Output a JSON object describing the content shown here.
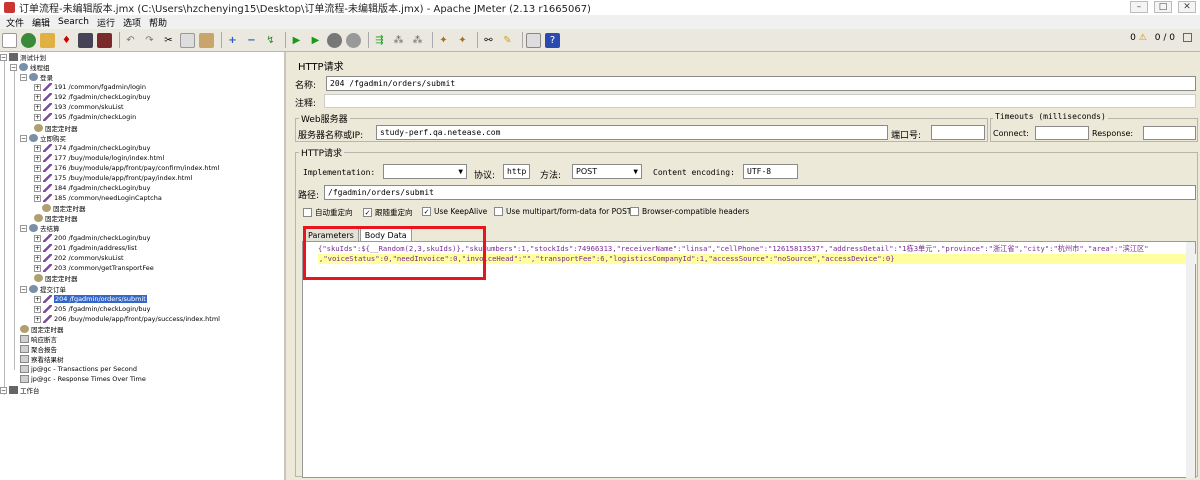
{
  "window": {
    "title": "订单流程-未编辑版本.jmx (C:\\Users\\hzchenying15\\Desktop\\订单流程-未编辑版本.jmx) - Apache JMeter (2.13 r1665067)"
  },
  "menu": [
    "文件",
    "编辑",
    "Search",
    "运行",
    "选项",
    "帮助"
  ],
  "status": {
    "warnings": "0",
    "threads": "0 / 0"
  },
  "tree": {
    "root": "测试计划",
    "group": "线程组",
    "items": [
      "登录",
      "191 /common/fgadmin/login",
      "192 /fgadmin/checkLogin/buy",
      "193 /common/skuList",
      "195 /fgadmin/checkLogin",
      "固定定时器",
      "立即购买",
      "174 /fgadmin/checkLogin/buy",
      "177 /buy/module/login/index.html",
      "176 /buy/module/app/front/pay/confirm/index.html",
      "175 /buy/module/app/front/pay/index.html",
      "184 /fgadmin/checkLogin/buy",
      "185 /common/needLoginCaptcha",
      "固定定时器",
      "固定定时器",
      "去结算",
      "200 /fgadmin/checkLogin/buy",
      "201 /fgadmin/address/list",
      "202 /common/skuList",
      "203 /common/getTransportFee",
      "固定定时器",
      "提交订单",
      "204 /fgadmin/orders/submit",
      "205 /fgadmin/checkLogin/buy",
      "206 /buy/module/app/front/pay/success/index.html",
      "固定定时器",
      "响应断言",
      "聚合报告",
      "察看结果树",
      "jp@gc - Transactions per Second",
      "jp@gc - Response Times Over Time"
    ],
    "workbench": "工作台"
  },
  "panel": {
    "title": "HTTP请求",
    "name_label": "名称:",
    "name_value": "204 /fgadmin/orders/submit",
    "comment_label": "注释:",
    "web_server_title": "Web服务器",
    "server_label": "服务器名称或IP:",
    "server_value": "study-perf.qa.netease.com",
    "port_label": "端口号:",
    "timeouts_title": "Timeouts (milliseconds)",
    "connect_label": "Connect:",
    "response_label": "Response:",
    "http_title": "HTTP请求",
    "impl_label": "Implementation:",
    "protocol_label": "协议:",
    "protocol_value": "http",
    "method_label": "方法:",
    "method_value": "POST",
    "encoding_label": "Content encoding:",
    "encoding_value": "UTF-8",
    "path_label": "路径:",
    "path_value": "/fgadmin/orders/submit",
    "checks": {
      "auto_redirect": "自动重定向",
      "follow_redirect": "跟随重定向",
      "keepalive": "Use KeepAlive",
      "multipart": "Use multipart/form-data for POST",
      "browser_headers": "Browser-compatible headers"
    },
    "tabs": [
      "Parameters",
      "Body Data"
    ],
    "body_line1": "{\"skuIds\":${__Random(2,3,skuIds)},\"skuNumbers\":1,\"stockIds\":74966313,\"receiverName\":\"linsa\",\"cellPhone\":\"12615813537\",\"addressDetail\":\"1栋3单元\",\"province\":\"浙江省\",\"city\":\"杭州市\",\"area\":\"滨江区\"",
    "body_line2": ",\"voiceStatus\":0,\"needInvoice\":0,\"invoiceHead\":\"\",\"transportFee\":6,\"logisticsCompanyId\":1,\"accessSource\":\"noSource\",\"accessDevice\":0}"
  }
}
